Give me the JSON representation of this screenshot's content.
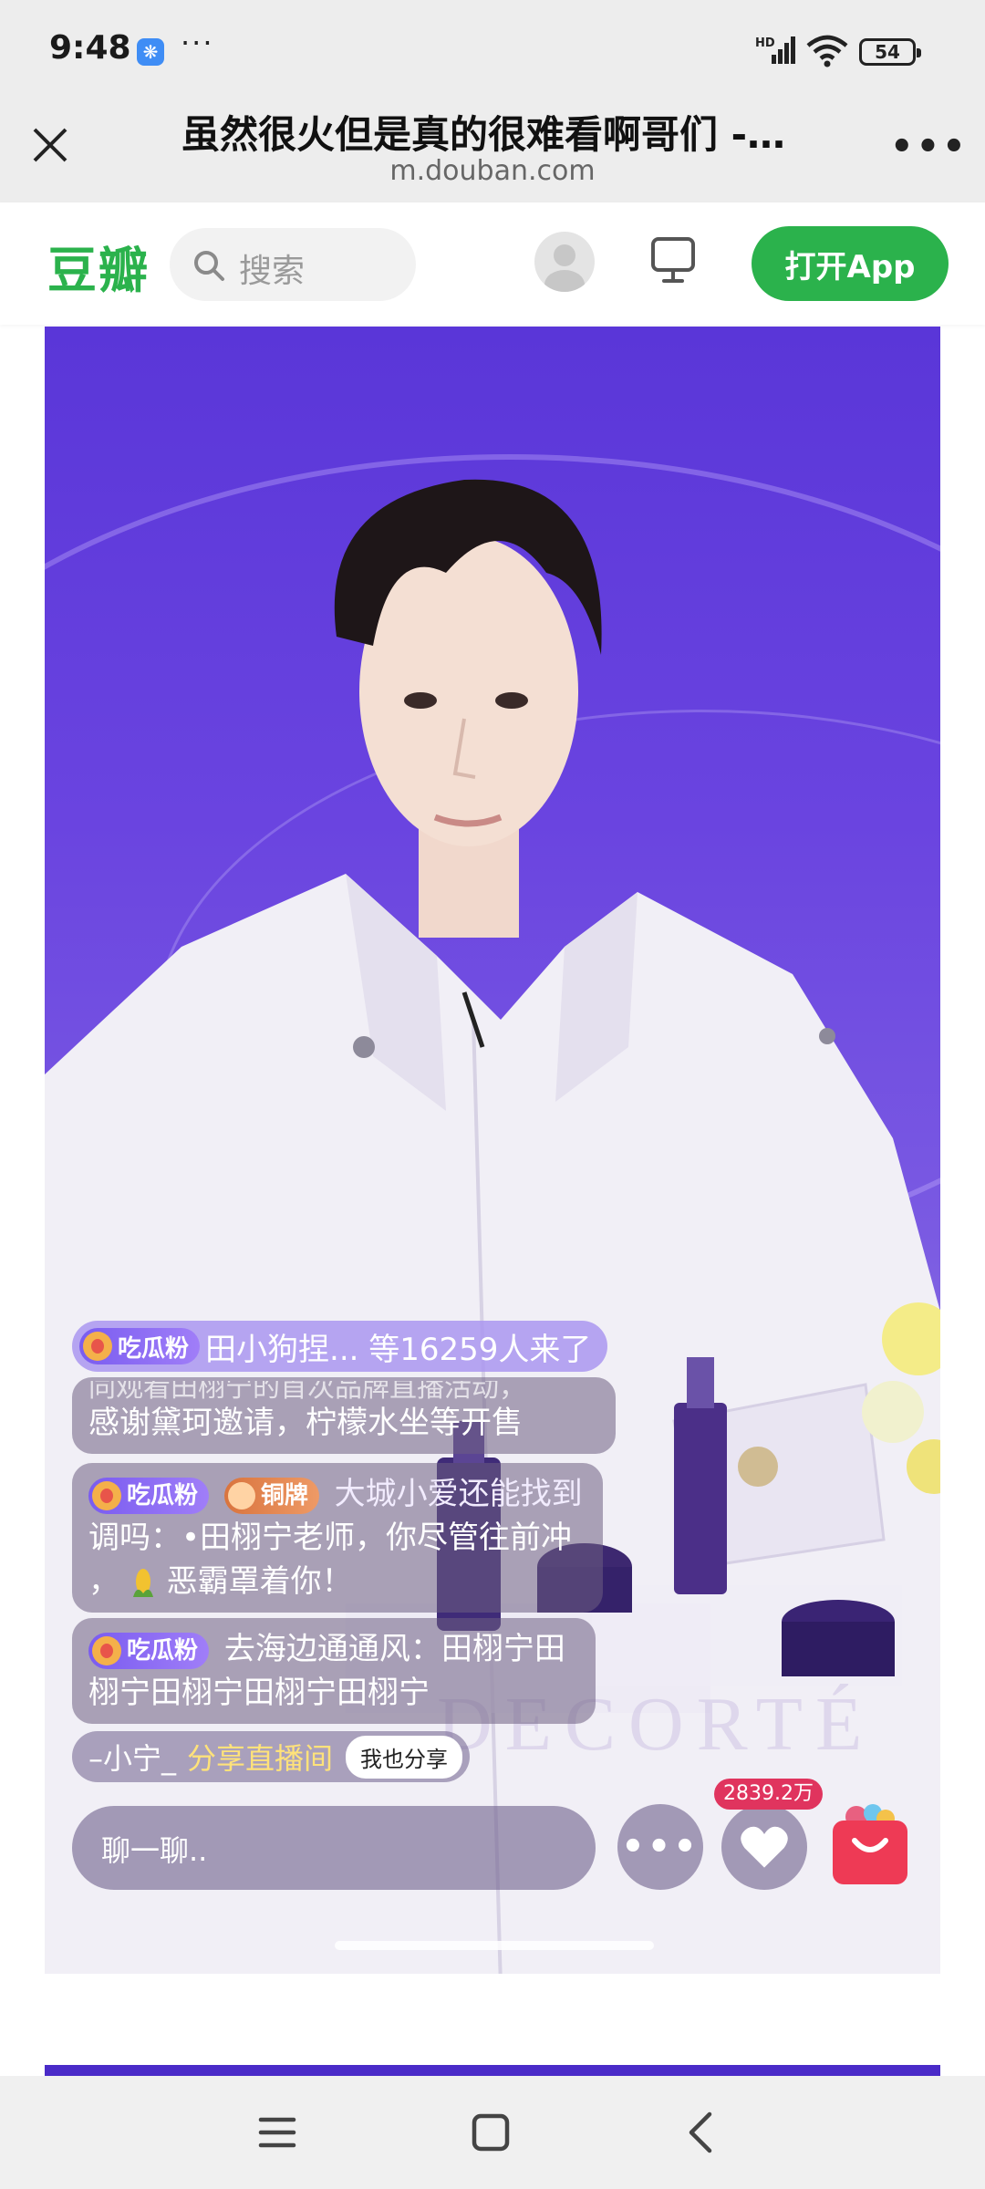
{
  "status_bar": {
    "time": "9:48",
    "more": "···",
    "network_label": "HD",
    "battery": "54",
    "icons": [
      "app-notification-icon",
      "signal-icon",
      "wifi-icon",
      "battery-icon"
    ]
  },
  "browser": {
    "title": "虽然很火但是真的很难看啊哥们 -…",
    "url": "m.douban.com",
    "icons": [
      "close-icon",
      "more-menu-icon"
    ]
  },
  "douban_header": {
    "logo": "豆瓣",
    "search_placeholder": "搜索",
    "open_app": "打开App",
    "accent": "#2bb24c",
    "icons": [
      "search-icon",
      "avatar-icon",
      "monitor-icon"
    ]
  },
  "live": {
    "join_notice": {
      "badge": "吃瓜粉",
      "text": "田小狗捏... 等16259人来了"
    },
    "comments": [
      {
        "lines": [
          "感谢黛珂邀请，柠檬水坐等开售"
        ],
        "partial_top": "同观看田栩宁的首次品牌直播活动，"
      },
      {
        "badges": [
          "吃瓜粉",
          "铜牌"
        ],
        "text_line1": "大城小爱还能找到",
        "text_line2": "调吗：•田栩宁老师，你尽管往前冲",
        "text_line3_prefix": "，",
        "text_line3": "恶霸罩着你！"
      },
      {
        "badges": [
          "吃瓜粉"
        ],
        "text_line1": "去海边通通风：田栩宁田",
        "text_line2": "栩宁田栩宁田栩宁田栩宁"
      }
    ],
    "share": {
      "user": "–小宁_",
      "action": "分享直播间",
      "button": "我也分享"
    },
    "chat_placeholder": "聊一聊..",
    "more_label": "•••",
    "like_count": "2839.2万",
    "brand_watermark": "DECORTÉ"
  },
  "nav_bar": {
    "icons": [
      "menu-icon",
      "home-icon",
      "back-icon"
    ]
  }
}
